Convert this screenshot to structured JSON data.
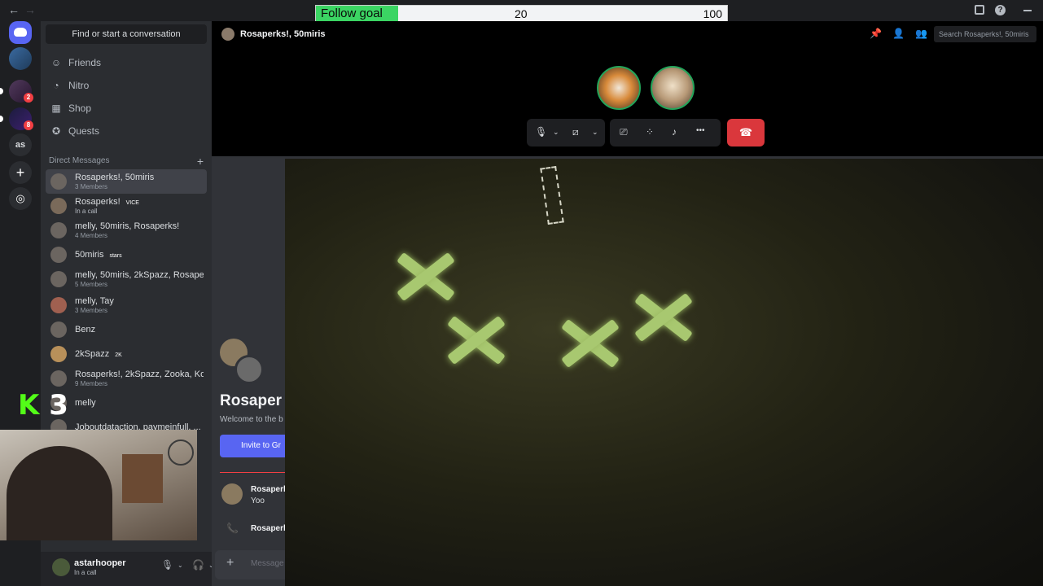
{
  "follow_goal": {
    "label": "Follow goal",
    "current": "20",
    "target": "100",
    "progress_fraction": 0.2,
    "fill_color": "#3bd563"
  },
  "titlebar": {
    "back_icon": "←",
    "forward_icon": "→",
    "help_icon": "?"
  },
  "servers": {
    "badges": [
      "2",
      "8"
    ],
    "as_label": "as",
    "add_icon": "+",
    "explore_icon": "◎"
  },
  "dm_panel": {
    "search_label": "Find or start a conversation",
    "nav": [
      {
        "label": "Friends",
        "icon": "☺"
      },
      {
        "label": "Nitro",
        "icon": "◔"
      },
      {
        "label": "Shop",
        "icon": "▦"
      },
      {
        "label": "Quests",
        "icon": "✪"
      }
    ],
    "section_title": "Direct Messages",
    "add_dm_icon": "+",
    "dms": [
      {
        "name": "Rosaperks!, 50miris",
        "sub": "3 Members",
        "active": true
      },
      {
        "name": "Rosaperks!",
        "tag": "VICE",
        "sub": "In a call"
      },
      {
        "name": "melly, 50miris, Rosaperks!",
        "sub": "4 Members"
      },
      {
        "name": "50miris",
        "tag": "stars"
      },
      {
        "name": "melly, 50miris, 2kSpazz, Rosape...",
        "sub": "5 Members"
      },
      {
        "name": "melly, Tay",
        "sub": "3 Members"
      },
      {
        "name": "Benz"
      },
      {
        "name": "2kSpazz",
        "tag": "2K"
      },
      {
        "name": "Rosaperks!, 2kSpazz, Zooka, Ko...",
        "sub": "9 Members"
      },
      {
        "name": "melly"
      },
      {
        "name": "Joboutdataction, paymeinfull, ..."
      }
    ]
  },
  "overlay": {
    "k_glyph": "K",
    "k_number": "3"
  },
  "userbar": {
    "username": "astarhooper",
    "status": "In a call",
    "mic_icon": "🎙",
    "headphones_icon": "🎧",
    "settings_icon": "⚙",
    "caret": "⌄"
  },
  "channel": {
    "title": "Rosaperks!, 50miris",
    "pin_icon": "📌",
    "add_friend_icon": "👤",
    "members_icon": "👥",
    "search_placeholder": "Search Rosaperks!, 50miris"
  },
  "call_controls": {
    "mic_icon": "🎙",
    "camera_icon": "⧄",
    "caret": "⌄",
    "screenshare_icon": "⎚",
    "activities_icon": "⁘",
    "soundboard_icon": "♪",
    "more_icon": "•••",
    "hangup_icon": "☎"
  },
  "welcome": {
    "big_title": "Rosaper",
    "description": "Welcome to the b",
    "invite_label": "Invite to Gr",
    "message_author": "Rosaperk",
    "message_text": "Yoo",
    "call_author": "Rosaperk",
    "phone_icon": "📞"
  },
  "message_box": {
    "plus_icon": "+",
    "placeholder": "Message"
  }
}
